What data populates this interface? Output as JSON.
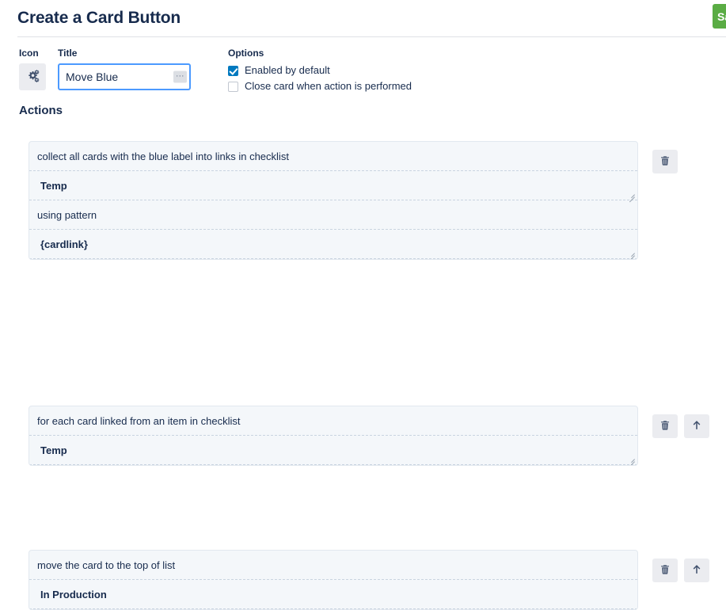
{
  "header": {
    "title": "Create a Card Button",
    "save_label": "Save",
    "save_color": "#5aac44"
  },
  "form": {
    "icon_label": "Icon",
    "icon_glyph": "cogs-icon",
    "title_label": "Title",
    "title_value": "Move Blue",
    "title_placeholder": "",
    "ellipsis_label": "...",
    "options_label": "Options",
    "options": [
      {
        "label": "Enabled by default",
        "checked": true
      },
      {
        "label": "Close card when action is performed",
        "checked": false
      }
    ],
    "checkbox_color": "#0079bf"
  },
  "actions": {
    "heading": "Actions",
    "items": [
      {
        "rows": [
          {
            "kind": "text",
            "text": "collect all cards with the blue label into links in checklist",
            "grip": false
          },
          {
            "kind": "value",
            "text": "Temp",
            "grip": true
          },
          {
            "kind": "text",
            "text": "using pattern",
            "grip": false
          },
          {
            "kind": "value",
            "text": "{cardlink}",
            "grip": true
          }
        ],
        "buttons": [
          "trash-icon"
        ]
      },
      {
        "rows": [
          {
            "kind": "text",
            "text": "for each card linked from an item in checklist",
            "grip": false
          },
          {
            "kind": "value",
            "text": "Temp",
            "grip": true
          }
        ],
        "buttons": [
          "trash-icon",
          "arrow-up-icon"
        ]
      },
      {
        "rows": [
          {
            "kind": "text",
            "text": "move the card to the top of list",
            "grip": false
          },
          {
            "kind": "value",
            "text": "In Production",
            "grip": false
          }
        ],
        "buttons": [
          "trash-icon",
          "arrow-up-icon"
        ]
      }
    ]
  }
}
